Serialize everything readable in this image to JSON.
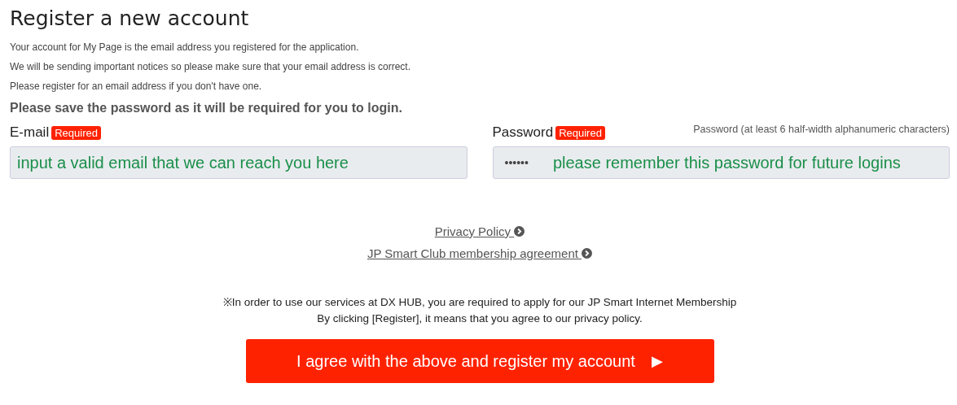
{
  "title": "Register a new account",
  "intro": [
    "Your account for My Page is the email address you registered for the application.",
    "We will be sending important notices so please make sure that your email address is correct.",
    "Please register for an email address if you don't have one."
  ],
  "notice": "Please save the password as it will be required for you to login.",
  "fields": [
    {
      "kind": "email",
      "label": "E-mail",
      "badge": "Required",
      "value": "input a valid email that we can reach you here"
    },
    {
      "kind": "password",
      "label": "Password",
      "badge": "Required",
      "hint": "Password (at least 6 half-width alphanumeric characters)",
      "value": "••••••",
      "annotation": "please remember this password for future logins"
    }
  ],
  "links": [
    "Privacy Policy",
    "JP Smart Club membership agreement"
  ],
  "terms": [
    "※In order to use our services at DX HUB, you are required to apply for our JP Smart Internet Membership",
    "By clicking [Register], it means that you agree to our privacy policy."
  ],
  "submit": {
    "label": "I agree with the above and register my account",
    "arrow": "▶"
  }
}
